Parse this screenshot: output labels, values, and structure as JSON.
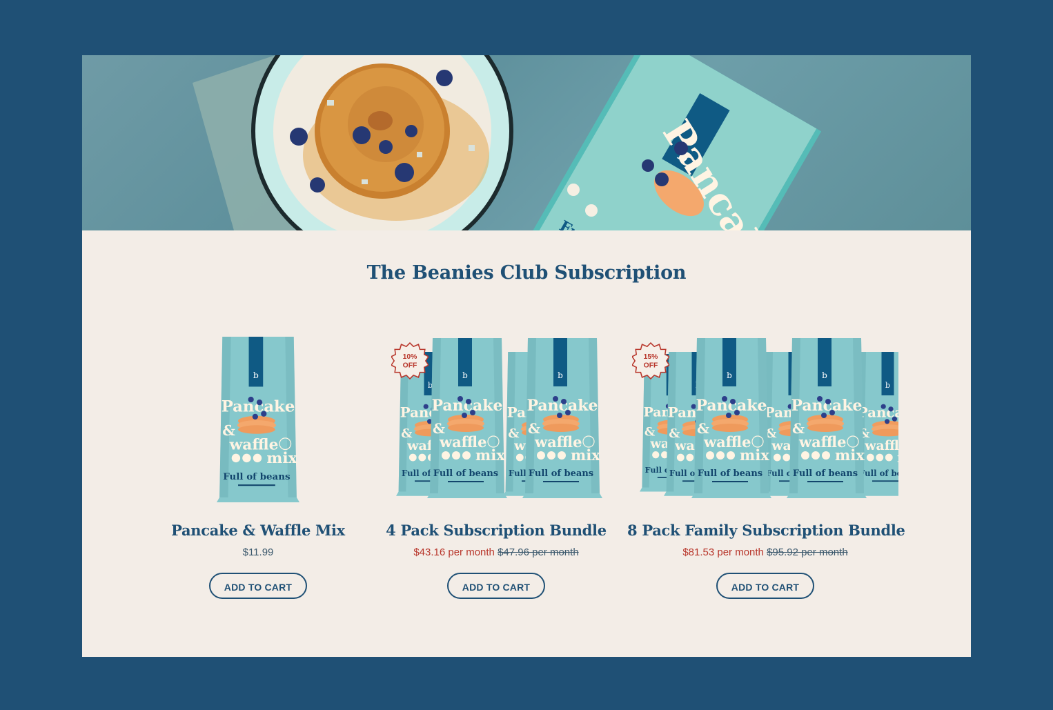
{
  "hero": {
    "bag_title": "Pancake & waffle",
    "bag_title_partial": "Fu"
  },
  "section": {
    "title": "The Beanies Club Subscription"
  },
  "bag_labels": {
    "brand_mark": "b",
    "line1": "Pancake",
    "line2": "& waffle",
    "line3": "mix",
    "brand": "Full of beans"
  },
  "products": [
    {
      "name": "Pancake & Waffle Mix",
      "price": "$11.99",
      "cta": "ADD TO CART"
    },
    {
      "name": "4 Pack Subscription Bundle",
      "sale_price": "$43.16 per month",
      "original_price": "$47.96 per month",
      "badge_line1": "10%",
      "badge_line2": "OFF",
      "cta": "ADD TO CART"
    },
    {
      "name": "8 Pack Family Subscription Bundle",
      "sale_price": "$81.53 per month",
      "original_price": "$95.92 per month",
      "badge_line1": "15%",
      "badge_line2": "OFF",
      "cta": "ADD TO CART"
    }
  ],
  "colors": {
    "outer_background": "#1f5075",
    "card_background": "#f3ede7",
    "primary_navy": "#1f5075",
    "sale_red": "#b8362b",
    "bag_teal": "#7fc4c9"
  }
}
